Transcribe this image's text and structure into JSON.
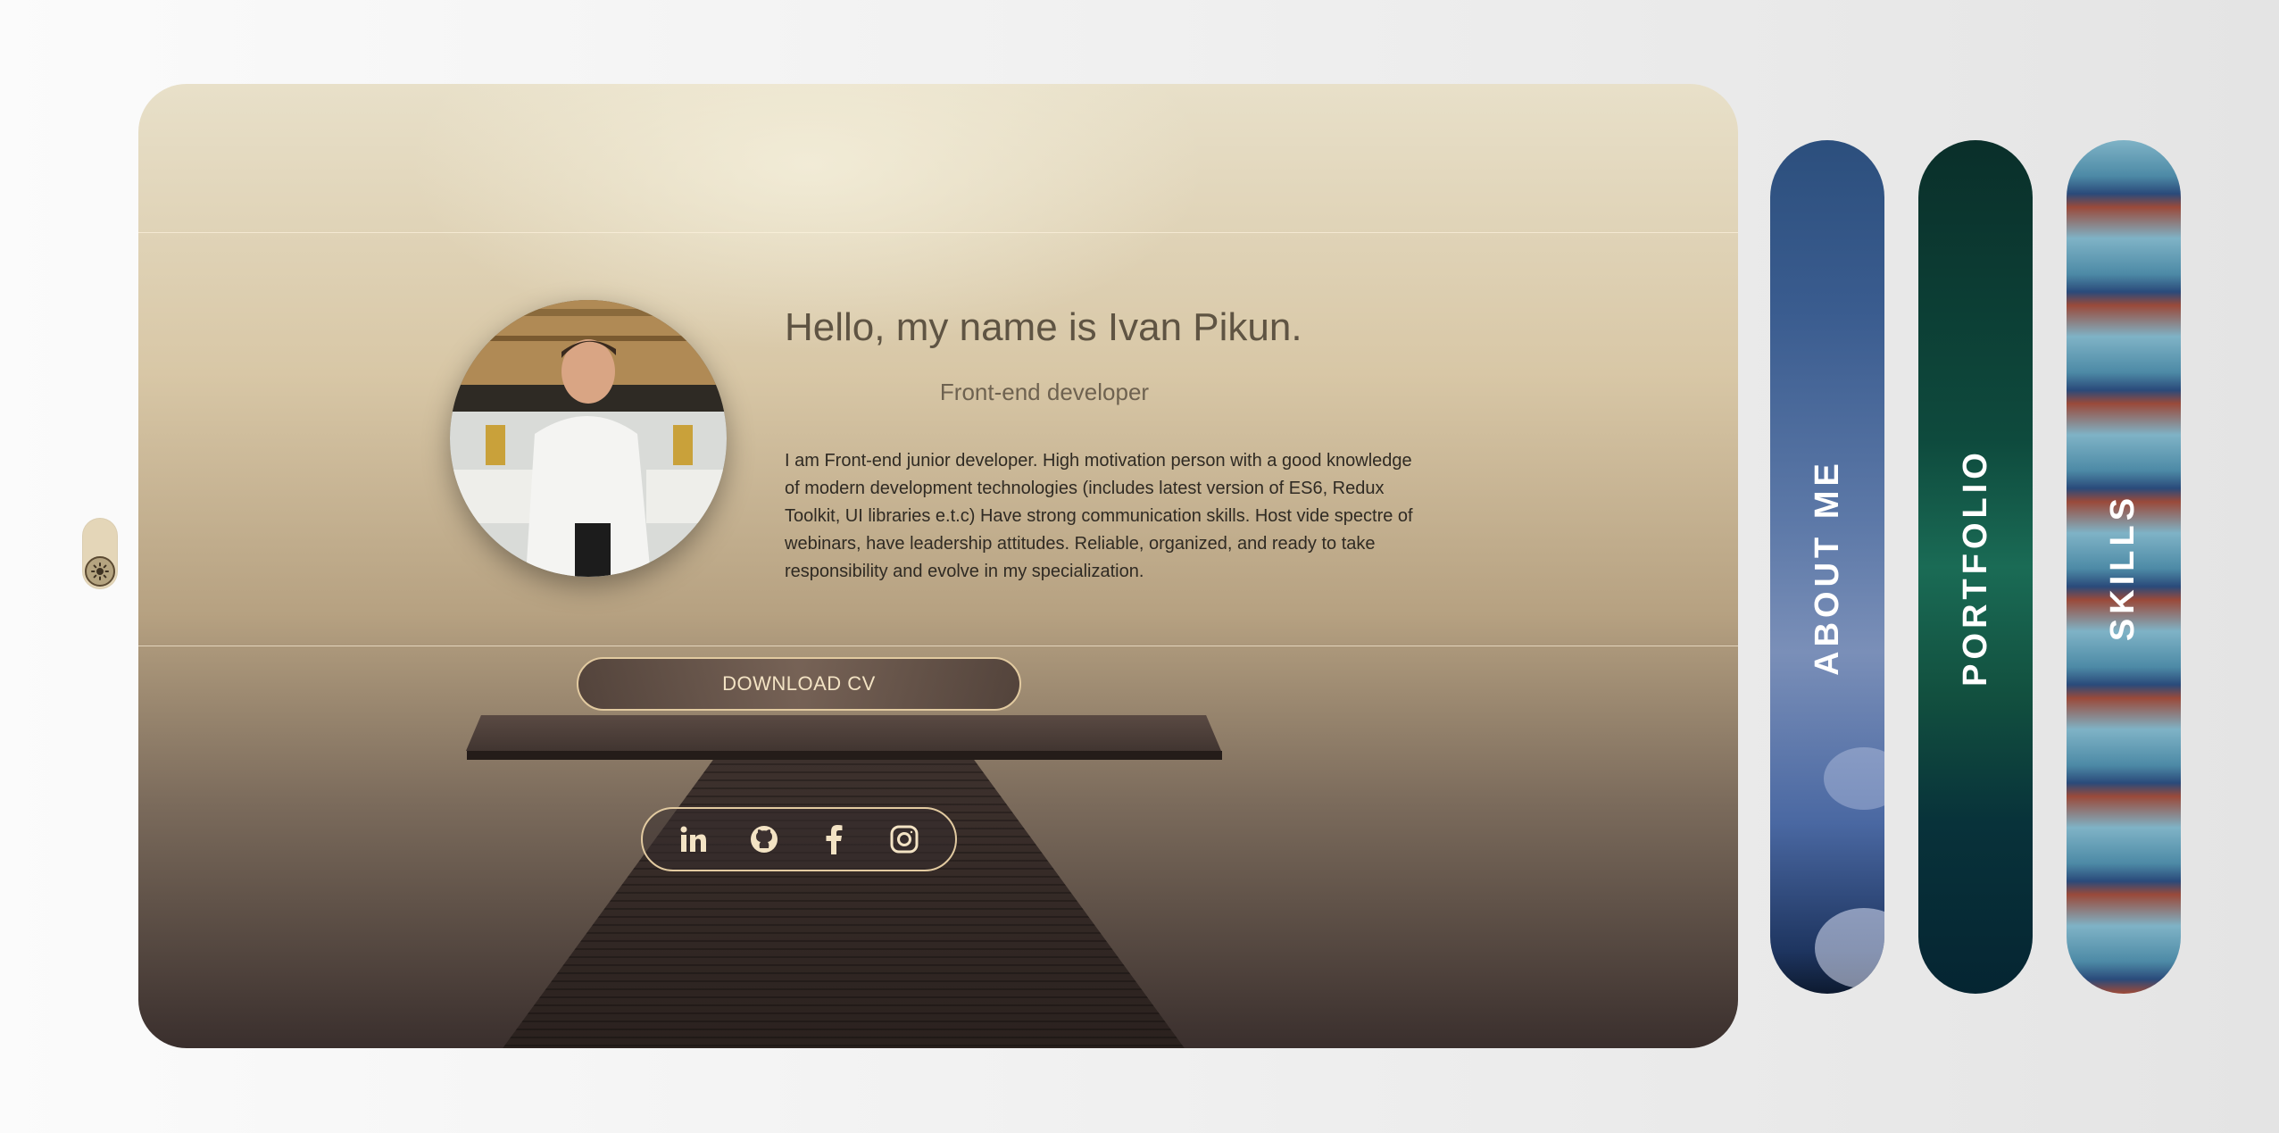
{
  "theme_toggle": {
    "icon": "sun-icon"
  },
  "profile": {
    "name": "Hello, my name is Ivan Pikun.",
    "role": "Front-end developer",
    "bio": "I am Front-end junior developer. High motivation person with a good knowledge of modern development technologies (includes latest version of ES6, Redux Toolkit, UI libraries e.t.c) Have strong communication skills. Host vide spectre of webinars, have leadership attitudes. Reliable, organized, and ready to take responsibility and evolve in my specialization."
  },
  "actions": {
    "download_cv": "DOWNLOAD CV"
  },
  "socials": [
    {
      "icon": "linkedin-icon"
    },
    {
      "icon": "github-icon"
    },
    {
      "icon": "facebook-icon"
    },
    {
      "icon": "instagram-icon"
    }
  ],
  "nav": [
    {
      "label": "ABOUT ME"
    },
    {
      "label": "PORTFOLIO"
    },
    {
      "label": "SKILLS"
    }
  ],
  "colors": {
    "accent_border": "#e2caa0",
    "heading": "#5f5443",
    "body_text": "#2f2a23"
  }
}
